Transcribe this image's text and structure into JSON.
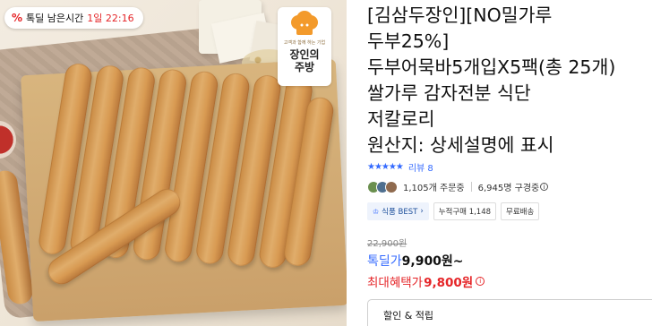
{
  "timer_badge": {
    "percent_icon": "percent-tag-icon",
    "label": "톡딜 남은시간",
    "time": "1일 22:16"
  },
  "brand_logo": {
    "tagline": "고객과 함께 하는 기업",
    "name_line1": "장인의",
    "name_line2": "주방"
  },
  "product": {
    "title_lines": [
      "[김삼두장인][NO밀가루",
      "두부25%]",
      "두부어묵바5개입X5팩(총 25개)",
      "쌀가루 감자전분 식단",
      "저칼로리",
      "원산지: 상세설명에 표시"
    ]
  },
  "rating": {
    "stars": "★★★★★",
    "rating_value": 4.5,
    "review_text": "리뷰 8"
  },
  "purchase_stats": {
    "orders": "1,105개 주문중",
    "subscribers": "6,945명 구경중"
  },
  "badges": {
    "best": "식품 BEST",
    "cumulative": "누적구매 1,148",
    "shipping": "무료배송"
  },
  "price": {
    "original": "22,900원",
    "deal_label": "톡딜가",
    "deal_value": "9,900원~",
    "max_label": "최대혜택가",
    "max_value": "9,800원"
  },
  "coupon": {
    "label": "할인 & 적립"
  },
  "colors": {
    "accent_blue": "#346aff",
    "accent_red": "#e52528"
  }
}
